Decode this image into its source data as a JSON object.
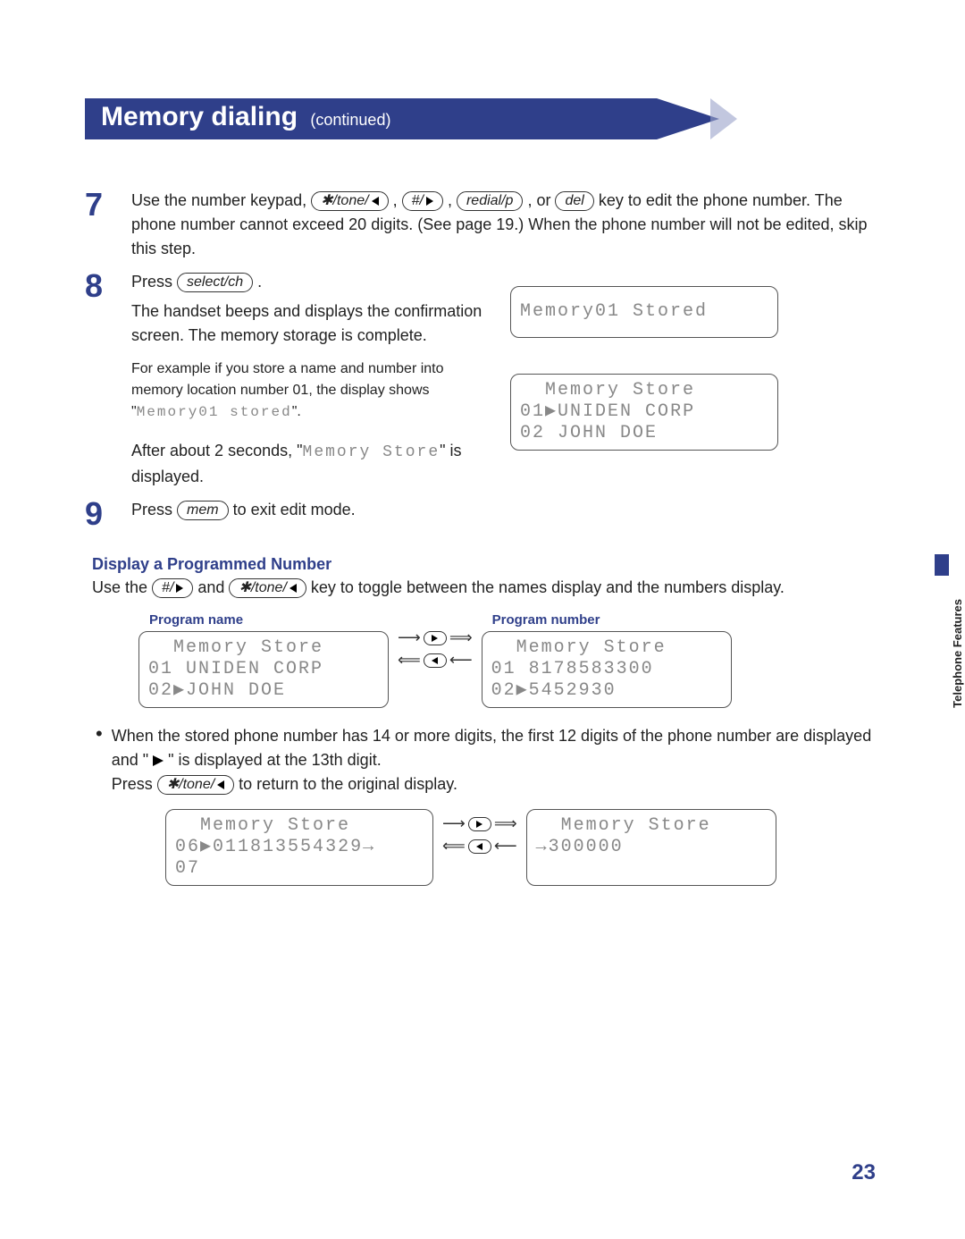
{
  "banner": {
    "title": "Memory dialing",
    "sub": "(continued)"
  },
  "keys": {
    "star_tone": "✱/tone/",
    "hash": "#/",
    "redial": "redial/p",
    "del": "del",
    "select_ch": "select/ch",
    "mem": "mem"
  },
  "step7": {
    "num": "7",
    "text_a": "Use the number keypad, ",
    "text_b": " , ",
    "text_c": " , ",
    "text_d": " , or ",
    "text_e": " key to edit the phone number. The phone number cannot exceed 20 digits. (See page 19.) When the phone number will not be edited, skip this step."
  },
  "step8": {
    "num": "8",
    "press": "Press ",
    "dot": " .",
    "p1": "The handset beeps and displays the confirmation screen. The memory storage is complete.",
    "p2a": "For example if you store a name and number into memory location number 01, the display shows \"",
    "p2_lcd": "Memory01 stored",
    "p2b": "\".",
    "p3a": "After about 2 seconds, \"",
    "p3_lcd": "Memory  Store",
    "p3b": "\" is displayed.",
    "screen1": "Memory01 Stored",
    "screen2_l1": "  Memory Store",
    "screen2_l2": "01▶UNIDEN CORP",
    "screen2_l3": "02 JOHN DOE"
  },
  "step9": {
    "num": "9",
    "a": "Press  ",
    "b": "  to exit edit mode."
  },
  "display_section": {
    "heading": "Display a Programmed Number",
    "p_a": "Use the ",
    "p_b": " and ",
    "p_c": " key to toggle between the names display and the numbers display.",
    "label_name": "Program name",
    "label_number": "Program number",
    "name_screen": {
      "l1": "  Memory Store",
      "l2": "01 UNIDEN CORP",
      "l3": "02▶JOHN DOE"
    },
    "number_screen": {
      "l1": "  Memory Store",
      "l2": "01 8178583300",
      "l3": "02▶5452930"
    }
  },
  "bullet": {
    "a": "When the stored phone number has 14 or more digits, the first 12 digits of the phone number are displayed and \" ",
    "b": " \" is displayed at the 13th digit.",
    "c": "Press ",
    "d": " to return to the original display."
  },
  "long_screens": {
    "left": {
      "l1": "  Memory Store",
      "l2": "06▶011813554329→",
      "l3": "07"
    },
    "right": {
      "l1": "  Memory Store",
      "l2": "→300000",
      "l3": " "
    }
  },
  "sidetab": "Telephone Features",
  "pagenum": "23"
}
